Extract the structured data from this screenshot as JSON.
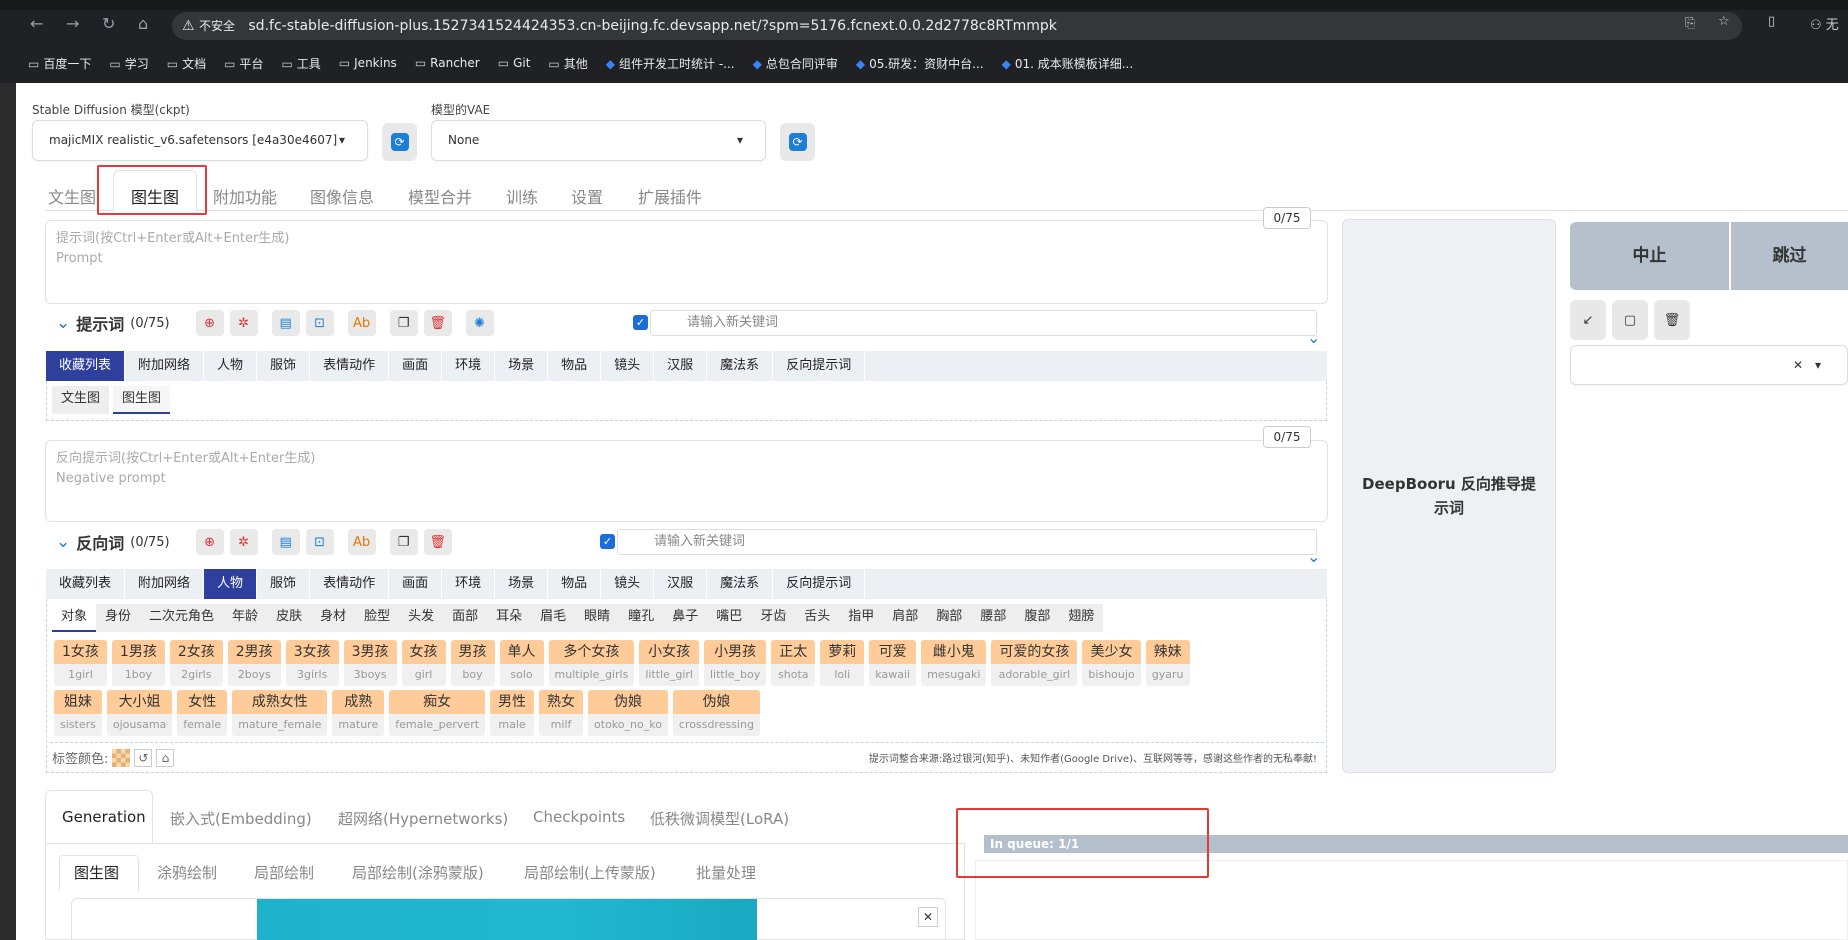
{
  "browser": {
    "insecure": "不安全",
    "url": "sd.fc-stable-diffusion-plus.1527341524424353.cn-beijing.fc.devsapp.net/?spm=5176.fcnext.0.0.2d2778c8RTmmpk",
    "profile": "无",
    "bookmarks": [
      "百度一下",
      "学习",
      "文档",
      "平台",
      "工具",
      "Jenkins",
      "Rancher",
      "Git",
      "其他",
      "组件开发工时统计 -...",
      "总包合同评审",
      "05.研发：资财中台...",
      "01. 成本账模板详细..."
    ]
  },
  "model": {
    "label": "Stable Diffusion 模型(ckpt)",
    "value": "majicMIX realistic_v6.safetensors [e4a30e4607]"
  },
  "vae": {
    "label": "模型的VAE",
    "value": "None"
  },
  "tabs": [
    "文生图",
    "图生图",
    "附加功能",
    "图像信息",
    "模型合并",
    "训练",
    "设置",
    "扩展插件"
  ],
  "prompt": {
    "counter": "0/75",
    "placeholder": "提示词(按Ctrl+Enter或Alt+Enter生成)",
    "placeholder2": "Prompt",
    "title": "提示词",
    "count": "(0/75)",
    "keyword_placeholder": "请输入新关键词"
  },
  "neg": {
    "counter": "0/75",
    "placeholder": "反向提示词(按Ctrl+Enter或Alt+Enter生成)",
    "placeholder2": "Negative prompt",
    "title": "反向词",
    "count": "(0/75)",
    "keyword_placeholder": "请输入新关键词"
  },
  "categories": [
    "收藏列表",
    "附加网络",
    "人物",
    "服饰",
    "表情动作",
    "画面",
    "环境",
    "场景",
    "物品",
    "镜头",
    "汉服",
    "魔法系",
    "反向提示词"
  ],
  "fav_subtabs": [
    "文生图",
    "图生图"
  ],
  "person_subtabs": [
    "对象",
    "身份",
    "二次元角色",
    "年龄",
    "皮肤",
    "身材",
    "脸型",
    "头发",
    "面部",
    "耳朵",
    "眉毛",
    "眼睛",
    "瞳孔",
    "鼻子",
    "嘴巴",
    "牙齿",
    "舌头",
    "指甲",
    "肩部",
    "胸部",
    "腰部",
    "腹部",
    "翅膀"
  ],
  "tags_row1": [
    [
      "1女孩",
      "1girl"
    ],
    [
      "1男孩",
      "1boy"
    ],
    [
      "2女孩",
      "2girls"
    ],
    [
      "2男孩",
      "2boys"
    ],
    [
      "3女孩",
      "3girls"
    ],
    [
      "3男孩",
      "3boys"
    ],
    [
      "女孩",
      "girl"
    ],
    [
      "男孩",
      "boy"
    ],
    [
      "单人",
      "solo"
    ],
    [
      "多个女孩",
      "multiple_girls"
    ],
    [
      "小女孩",
      "little_girl"
    ],
    [
      "小男孩",
      "little_boy"
    ],
    [
      "正太",
      "shota"
    ],
    [
      "萝莉",
      "loli"
    ],
    [
      "可爱",
      "kawaii"
    ],
    [
      "雌小鬼",
      "mesugaki"
    ],
    [
      "可爱的女孩",
      "adorable_girl"
    ],
    [
      "美少女",
      "bishoujo"
    ],
    [
      "辣妹",
      "gyaru"
    ]
  ],
  "tags_row2": [
    [
      "姐妹",
      "sisters"
    ],
    [
      "大小姐",
      "ojousama"
    ],
    [
      "女性",
      "female"
    ],
    [
      "成熟女性",
      "mature_female"
    ],
    [
      "成熟",
      "mature"
    ],
    [
      "痴女",
      "female_pervert"
    ],
    [
      "男性",
      "male"
    ],
    [
      "熟女",
      "milf"
    ],
    [
      "伪娘",
      "otoko_no_ko"
    ],
    [
      "伪娘",
      "crossdressing"
    ]
  ],
  "footer": {
    "color_label": "标签颜色:",
    "credit": "提示词整合来源:路过银河(知乎)、未知作者(Google Drive)、互联网等等，感谢这些作者的无私奉献!"
  },
  "deepbooru": "DeepBooru 反向推导提示词",
  "actions": {
    "interrupt": "中止",
    "skip": "跳过"
  },
  "bottom_tabs": [
    "Generation",
    "嵌入式(Embedding)",
    "超网络(Hypernetworks)",
    "Checkpoints",
    "低秩微调模型(LoRA)"
  ],
  "img_tabs": [
    "图生图",
    "涂鸦绘制",
    "局部绘制",
    "局部绘制(涂鸦蒙版)",
    "局部绘制(上传蒙版)",
    "批量处理"
  ],
  "queue": "In queue: 1/1"
}
